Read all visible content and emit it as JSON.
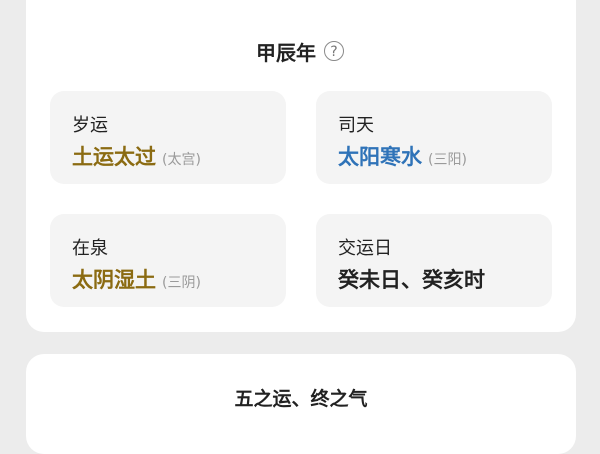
{
  "header": {
    "year_title": "甲辰年",
    "help_glyph": "?"
  },
  "cards": {
    "suiyun": {
      "label": "岁运",
      "value": "土运太过",
      "note": "(太宫)",
      "value_color": "#8b6b12"
    },
    "sitian": {
      "label": "司天",
      "value": "太阳寒水",
      "note": "(三阳)",
      "value_color": "#2f73b8"
    },
    "zaiquan": {
      "label": "在泉",
      "value": "太阴湿土",
      "note": "(三阴)",
      "value_color": "#8b6b12"
    },
    "jiaoyunri": {
      "label": "交运日",
      "value": "癸未日、癸亥时",
      "value_color": "#222222"
    }
  },
  "bottom": {
    "title": "五之运、终之气"
  },
  "icons": [
    "planet-icon",
    "help-icon"
  ]
}
